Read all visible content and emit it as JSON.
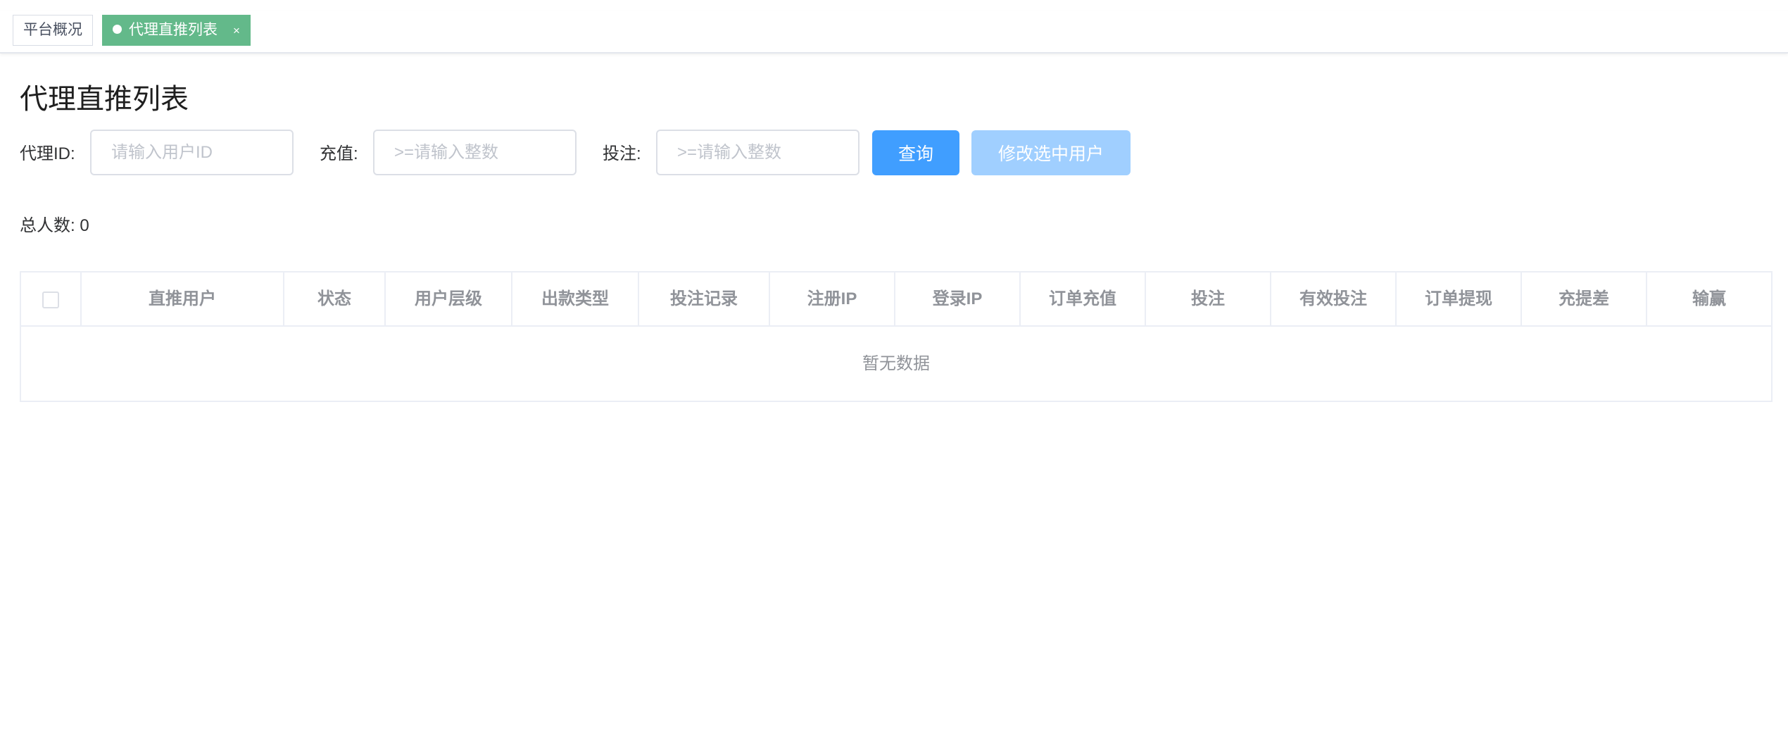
{
  "tabs": [
    {
      "label": "平台概况",
      "active": false
    },
    {
      "label": "代理直推列表",
      "active": true,
      "close": "×"
    }
  ],
  "page": {
    "title": "代理直推列表"
  },
  "filters": {
    "agent_id": {
      "label": "代理ID:",
      "placeholder": "请输入用户ID",
      "value": ""
    },
    "recharge": {
      "label": "充值:",
      "placeholder": ">=请输入整数",
      "value": ""
    },
    "bet": {
      "label": "投注:",
      "placeholder": ">=请输入整数",
      "value": ""
    }
  },
  "buttons": {
    "query": "查询",
    "modify": "修改选中用户"
  },
  "summary": {
    "total_label": "总人数:",
    "total_value": "0"
  },
  "table": {
    "columns": [
      "直推用户",
      "状态",
      "用户层级",
      "出款类型",
      "投注记录",
      "注册IP",
      "登录IP",
      "订单充值",
      "投注",
      "有效投注",
      "订单提现",
      "充提差",
      "输赢"
    ],
    "rows": [],
    "empty_text": "暂无数据"
  },
  "colors": {
    "tab_active": "#63b98a",
    "primary": "#409eff",
    "primary_disabled": "#a0cfff"
  }
}
